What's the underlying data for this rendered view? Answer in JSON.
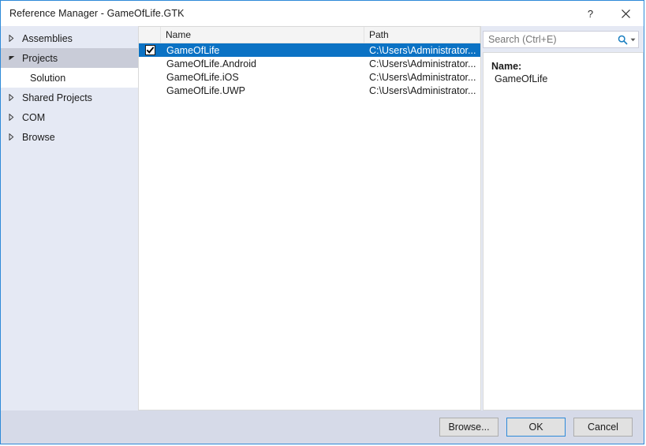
{
  "window": {
    "title": "Reference Manager - GameOfLife.GTK",
    "help_label": "?",
    "close_label": "✕",
    "accent_color": "#0b72c4",
    "border_color": "#2e8ad8"
  },
  "sidebar": {
    "items": [
      {
        "label": "Assemblies",
        "state": "collapsed",
        "level": 0,
        "selected": false
      },
      {
        "label": "Projects",
        "state": "expanded",
        "level": 0,
        "selected": true
      },
      {
        "label": "Solution",
        "state": "leaf",
        "level": 1,
        "selected": false
      },
      {
        "label": "Shared Projects",
        "state": "collapsed",
        "level": 0,
        "selected": false
      },
      {
        "label": "COM",
        "state": "collapsed",
        "level": 0,
        "selected": false
      },
      {
        "label": "Browse",
        "state": "collapsed",
        "level": 0,
        "selected": false
      }
    ]
  },
  "search": {
    "placeholder": "Search (Ctrl+E)",
    "value": "",
    "icon": "search-icon",
    "dropdown_icon": "chevron-down-icon"
  },
  "list": {
    "columns": [
      "",
      "Name",
      "Path"
    ],
    "rows": [
      {
        "checked": true,
        "name": "GameOfLife",
        "path": "C:\\Users\\Administrator...",
        "selected": true
      },
      {
        "checked": false,
        "name": "GameOfLife.Android",
        "path": "C:\\Users\\Administrator...",
        "selected": false
      },
      {
        "checked": false,
        "name": "GameOfLife.iOS",
        "path": "C:\\Users\\Administrator...",
        "selected": false
      },
      {
        "checked": false,
        "name": "GameOfLife.UWP",
        "path": "C:\\Users\\Administrator...",
        "selected": false
      }
    ]
  },
  "detail": {
    "name_label": "Name:",
    "name_value": "GameOfLife"
  },
  "footer": {
    "browse_label": "Browse...",
    "ok_label": "OK",
    "cancel_label": "Cancel"
  }
}
